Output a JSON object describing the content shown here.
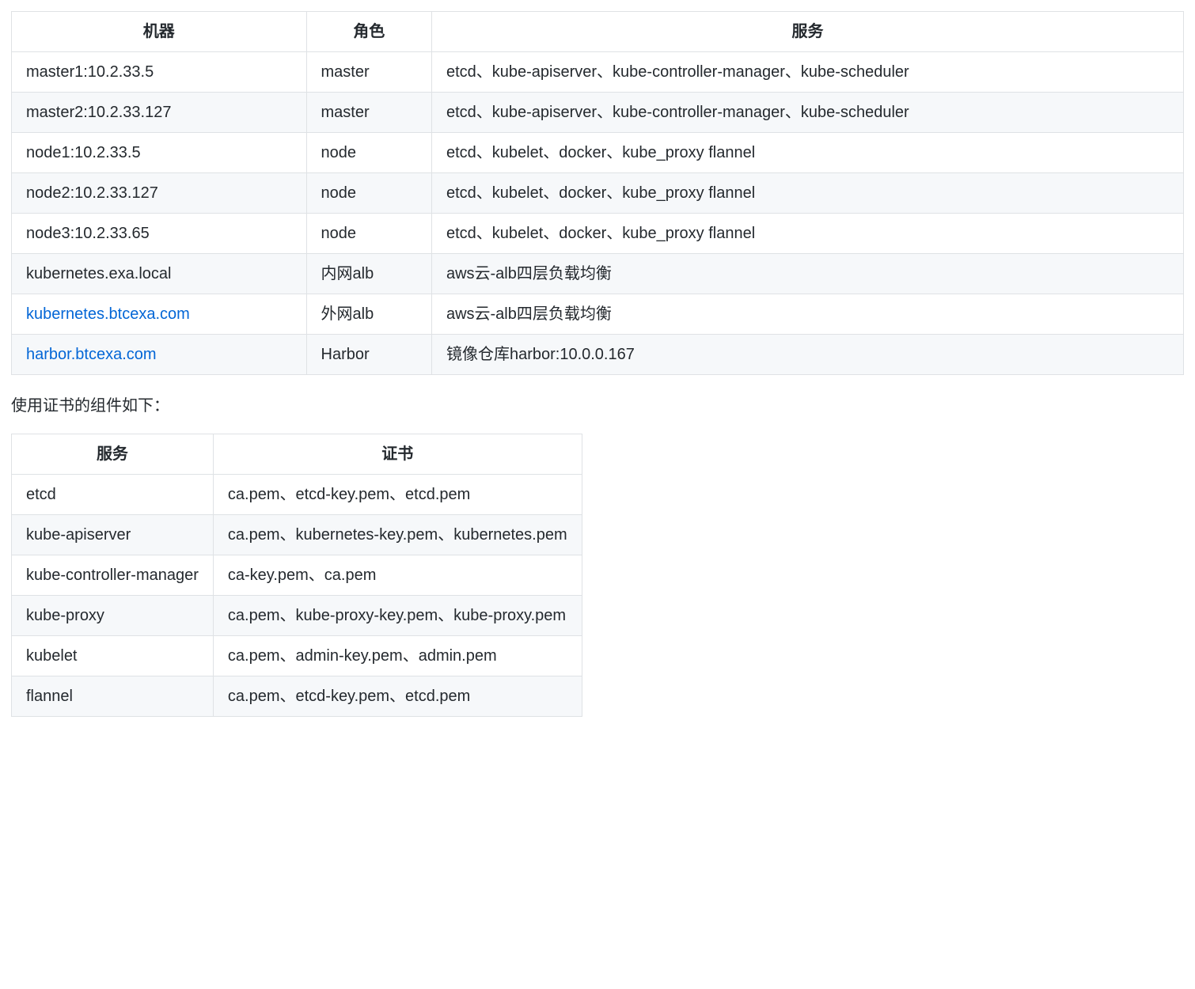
{
  "table1": {
    "headers": [
      "机器",
      "角色",
      "服务"
    ],
    "rows": [
      {
        "machine": "master1:10.2.33.5",
        "role": "master",
        "services": "etcd、kube-apiserver、kube-controller-manager、kube-scheduler",
        "link": false
      },
      {
        "machine": "master2:10.2.33.127",
        "role": "master",
        "services": "etcd、kube-apiserver、kube-controller-manager、kube-scheduler",
        "link": false
      },
      {
        "machine": "node1:10.2.33.5",
        "role": "node",
        "services": "etcd、kubelet、docker、kube_proxy flannel",
        "link": false
      },
      {
        "machine": "node2:10.2.33.127",
        "role": "node",
        "services": "etcd、kubelet、docker、kube_proxy flannel",
        "link": false
      },
      {
        "machine": "node3:10.2.33.65",
        "role": "node",
        "services": "etcd、kubelet、docker、kube_proxy flannel",
        "link": false
      },
      {
        "machine": "kubernetes.exa.local",
        "role": "内网alb",
        "services": "aws云-alb四层负载均衡",
        "link": false
      },
      {
        "machine": "kubernetes.btcexa.com",
        "role": "外网alb",
        "services": "aws云-alb四层负载均衡",
        "link": true
      },
      {
        "machine": "harbor.btcexa.com",
        "role": "Harbor",
        "services": "镜像仓库harbor:10.0.0.167",
        "link": true
      }
    ]
  },
  "note_text": "使用证书的组件如下：",
  "table2": {
    "headers": [
      "服务",
      "证书"
    ],
    "rows": [
      {
        "service": "etcd",
        "certs": "ca.pem、etcd-key.pem、etcd.pem"
      },
      {
        "service": "kube-apiserver",
        "certs": "ca.pem、kubernetes-key.pem、kubernetes.pem"
      },
      {
        "service": "kube-controller-manager",
        "certs": "ca-key.pem、ca.pem"
      },
      {
        "service": "kube-proxy",
        "certs": "ca.pem、kube-proxy-key.pem、kube-proxy.pem"
      },
      {
        "service": "kubelet",
        "certs": "ca.pem、admin-key.pem、admin.pem"
      },
      {
        "service": "flannel",
        "certs": "ca.pem、etcd-key.pem、etcd.pem"
      }
    ]
  }
}
